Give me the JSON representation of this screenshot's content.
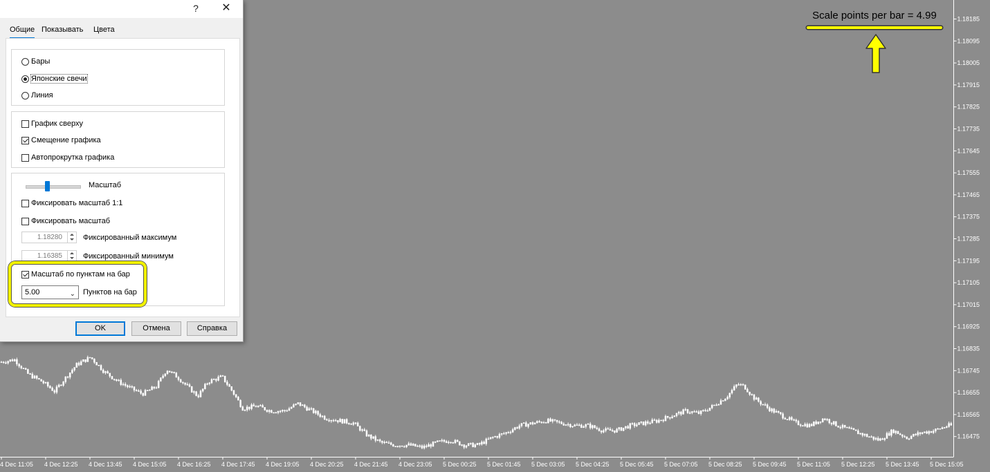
{
  "chart": {
    "price_ticks": [
      "1.18185",
      "1.18095",
      "1.18005",
      "1.17915",
      "1.17825",
      "1.17735",
      "1.17645",
      "1.17555",
      "1.17465",
      "1.17375",
      "1.17285",
      "1.17195",
      "1.17105",
      "1.17015",
      "1.16925",
      "1.16835",
      "1.16745",
      "1.16655",
      "1.16565",
      "1.16475"
    ],
    "time_ticks": [
      "4 Dec 11:05",
      "4 Dec 12:25",
      "4 Dec 13:45",
      "4 Dec 15:05",
      "4 Dec 16:25",
      "4 Dec 17:45",
      "4 Dec 19:05",
      "4 Dec 20:25",
      "4 Dec 21:45",
      "4 Dec 23:05",
      "5 Dec 00:25",
      "5 Dec 01:45",
      "5 Dec 03:05",
      "5 Dec 04:25",
      "5 Dec 05:45",
      "5 Dec 07:05",
      "5 Dec 08:25",
      "5 Dec 09:45",
      "5 Dec 11:05",
      "5 Dec 12:25",
      "5 Dec 13:45",
      "5 Dec 15:05"
    ],
    "colors": {
      "background": "#8c8c8c",
      "foreground": "#ffffff"
    }
  },
  "chart_data": {
    "type": "candlestick",
    "x_labels": [
      "4 Dec 11:05",
      "4 Dec 12:25",
      "4 Dec 13:45",
      "4 Dec 15:05",
      "4 Dec 16:25",
      "4 Dec 17:45",
      "4 Dec 19:05",
      "4 Dec 20:25",
      "4 Dec 21:45",
      "4 Dec 23:05",
      "5 Dec 00:25",
      "5 Dec 01:45",
      "5 Dec 03:05",
      "5 Dec 04:25",
      "5 Dec 05:45",
      "5 Dec 07:05",
      "5 Dec 08:25",
      "5 Dec 09:45",
      "5 Dec 11:05",
      "5 Dec 12:25",
      "5 Dec 13:45",
      "5 Dec 15:05"
    ],
    "ylim": [
      1.1641,
      1.1822
    ],
    "close_path": [
      [
        0,
        1.1678
      ],
      [
        20,
        1.1679
      ],
      [
        40,
        1.1673
      ],
      [
        60,
        1.167
      ],
      [
        78,
        1.1666
      ],
      [
        95,
        1.1672
      ],
      [
        110,
        1.1677
      ],
      [
        130,
        1.168
      ],
      [
        150,
        1.1674
      ],
      [
        170,
        1.167
      ],
      [
        190,
        1.1667
      ],
      [
        205,
        1.1665
      ],
      [
        225,
        1.1668
      ],
      [
        240,
        1.1675
      ],
      [
        255,
        1.1672
      ],
      [
        270,
        1.1668
      ],
      [
        285,
        1.1664
      ],
      [
        300,
        1.167
      ],
      [
        320,
        1.1672
      ],
      [
        335,
        1.1666
      ],
      [
        350,
        1.1659
      ],
      [
        370,
        1.166
      ],
      [
        390,
        1.1658
      ],
      [
        410,
        1.1658
      ],
      [
        430,
        1.1661
      ],
      [
        450,
        1.1658
      ],
      [
        470,
        1.1655
      ],
      [
        490,
        1.1654
      ],
      [
        510,
        1.1653
      ],
      [
        530,
        1.1648
      ],
      [
        550,
        1.1645
      ],
      [
        570,
        1.1644
      ],
      [
        590,
        1.1644
      ],
      [
        610,
        1.1643
      ],
      [
        630,
        1.1645
      ],
      [
        650,
        1.1646
      ],
      [
        670,
        1.1644
      ],
      [
        690,
        1.1644
      ],
      [
        710,
        1.1647
      ],
      [
        730,
        1.1649
      ],
      [
        750,
        1.1652
      ],
      [
        770,
        1.1653
      ],
      [
        790,
        1.1654
      ],
      [
        810,
        1.1653
      ],
      [
        830,
        1.1652
      ],
      [
        850,
        1.1652
      ],
      [
        870,
        1.165
      ],
      [
        890,
        1.165
      ],
      [
        910,
        1.1652
      ],
      [
        930,
        1.1653
      ],
      [
        950,
        1.1654
      ],
      [
        970,
        1.1656
      ],
      [
        990,
        1.1658
      ],
      [
        1010,
        1.1657
      ],
      [
        1030,
        1.166
      ],
      [
        1050,
        1.1664
      ],
      [
        1065,
        1.1669
      ],
      [
        1075,
        1.1668
      ],
      [
        1090,
        1.1663
      ],
      [
        1110,
        1.1659
      ],
      [
        1130,
        1.1656
      ],
      [
        1150,
        1.1653
      ],
      [
        1170,
        1.1652
      ],
      [
        1190,
        1.1655
      ],
      [
        1210,
        1.1652
      ],
      [
        1230,
        1.165
      ],
      [
        1250,
        1.1648
      ],
      [
        1270,
        1.1646
      ],
      [
        1290,
        1.165
      ],
      [
        1310,
        1.1647
      ],
      [
        1330,
        1.1649
      ],
      [
        1350,
        1.165
      ],
      [
        1370,
        1.1652
      ]
    ]
  },
  "annotation": {
    "text": "Scale points per bar = 4.99",
    "color": "#ffff00"
  },
  "dialog": {
    "help_glyph": "?",
    "close_glyph": "✕",
    "tabs": [
      "Общие",
      "Показывать",
      "Цвета"
    ],
    "chart_type": {
      "options": [
        "Бары",
        "Японские свечи",
        "Линия"
      ],
      "selected": "Японские свечи"
    },
    "checks1": [
      {
        "label": "График сверху",
        "checked": false
      },
      {
        "label": "Смещение графика",
        "checked": true
      },
      {
        "label": "Автопрокрутка графика",
        "checked": false
      }
    ],
    "scale_label": "Масштаб",
    "fix_scale_11": "Фиксировать масштаб 1:1",
    "fix_scale": "Фиксировать масштаб",
    "fixed_max_value": "1.18280",
    "fixed_max_label": "Фиксированный максимум",
    "fixed_min_value": "1.16385",
    "fixed_min_label": "Фиксированный минимум",
    "scale_per_bar_label": "Масштаб по пунктам на бар",
    "scale_per_bar_checked": true,
    "points_value": "5.00",
    "points_label": "Пунктов на бар",
    "buttons": {
      "ok": "OK",
      "cancel": "Отмена",
      "help": "Справка"
    }
  }
}
